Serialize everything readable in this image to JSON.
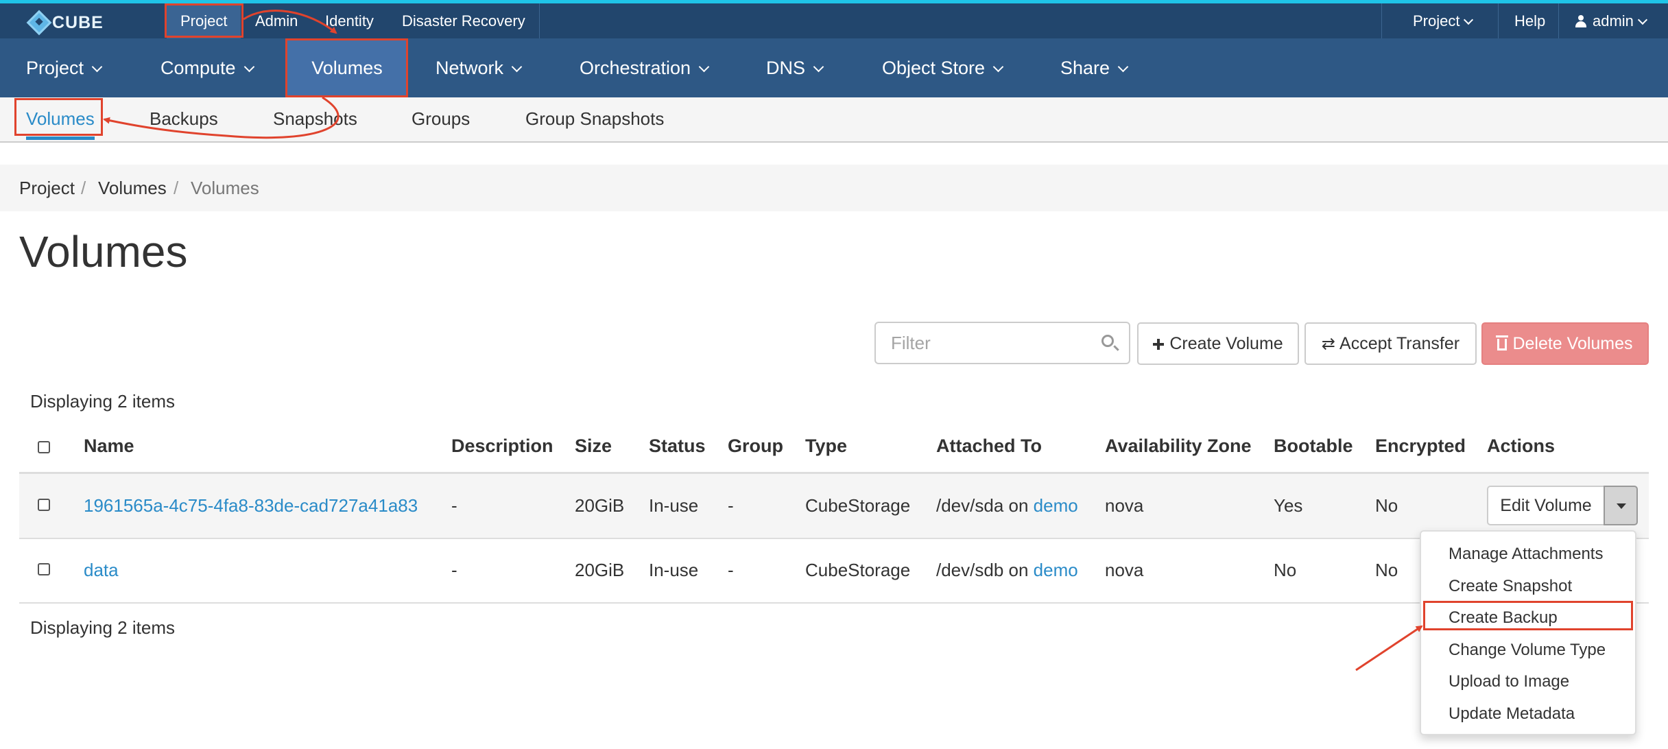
{
  "topbar": {
    "logo_text": "CUBE",
    "items": [
      "Project",
      "Admin",
      "Identity",
      "Disaster Recovery"
    ],
    "right": {
      "project_label": "Project",
      "help_label": "Help",
      "user_label": "admin"
    }
  },
  "mainnav": {
    "items": [
      "Project",
      "Compute",
      "Volumes",
      "Network",
      "Orchestration",
      "DNS",
      "Object Store",
      "Share"
    ]
  },
  "subnav": {
    "items": [
      "Volumes",
      "Backups",
      "Snapshots",
      "Groups",
      "Group Snapshots"
    ]
  },
  "breadcrumb": [
    "Project",
    "Volumes",
    "Volumes"
  ],
  "breadcrumb_sep": "/",
  "page_title": "Volumes",
  "toolbar": {
    "filter_placeholder": "Filter",
    "create_label": "Create Volume",
    "accept_label": "Accept Transfer",
    "delete_label": "Delete Volumes"
  },
  "count_text": "Displaying 2 items",
  "table": {
    "columns": [
      "Name",
      "Description",
      "Size",
      "Status",
      "Group",
      "Type",
      "Attached To",
      "Availability Zone",
      "Bootable",
      "Encrypted",
      "Actions"
    ],
    "rows": [
      {
        "name": "1961565a-4c75-4fa8-83de-cad727a41a83",
        "description": "-",
        "size": "20GiB",
        "status": "In-use",
        "group": "-",
        "type": "CubeStorage",
        "attached_prefix": "/dev/sda on",
        "attached_link": "demo",
        "zone": "nova",
        "bootable": "Yes",
        "encrypted": "No"
      },
      {
        "name": "data",
        "description": "-",
        "size": "20GiB",
        "status": "In-use",
        "group": "-",
        "type": "CubeStorage",
        "attached_prefix": "/dev/sdb on",
        "attached_link": "demo",
        "zone": "nova",
        "bootable": "No",
        "encrypted": "No"
      }
    ],
    "edit_label": "Edit Volume"
  },
  "actions_menu": [
    "Manage Attachments",
    "Create Snapshot",
    "Create Backup",
    "Change Volume Type",
    "Upload to Image",
    "Update Metadata"
  ],
  "colors": {
    "topbar": "#22466d",
    "mainnav": "#2e5885",
    "active": "#4470a8",
    "link": "#2a8bc8",
    "danger": "#eb8c8c",
    "annotation": "#e0432d"
  }
}
